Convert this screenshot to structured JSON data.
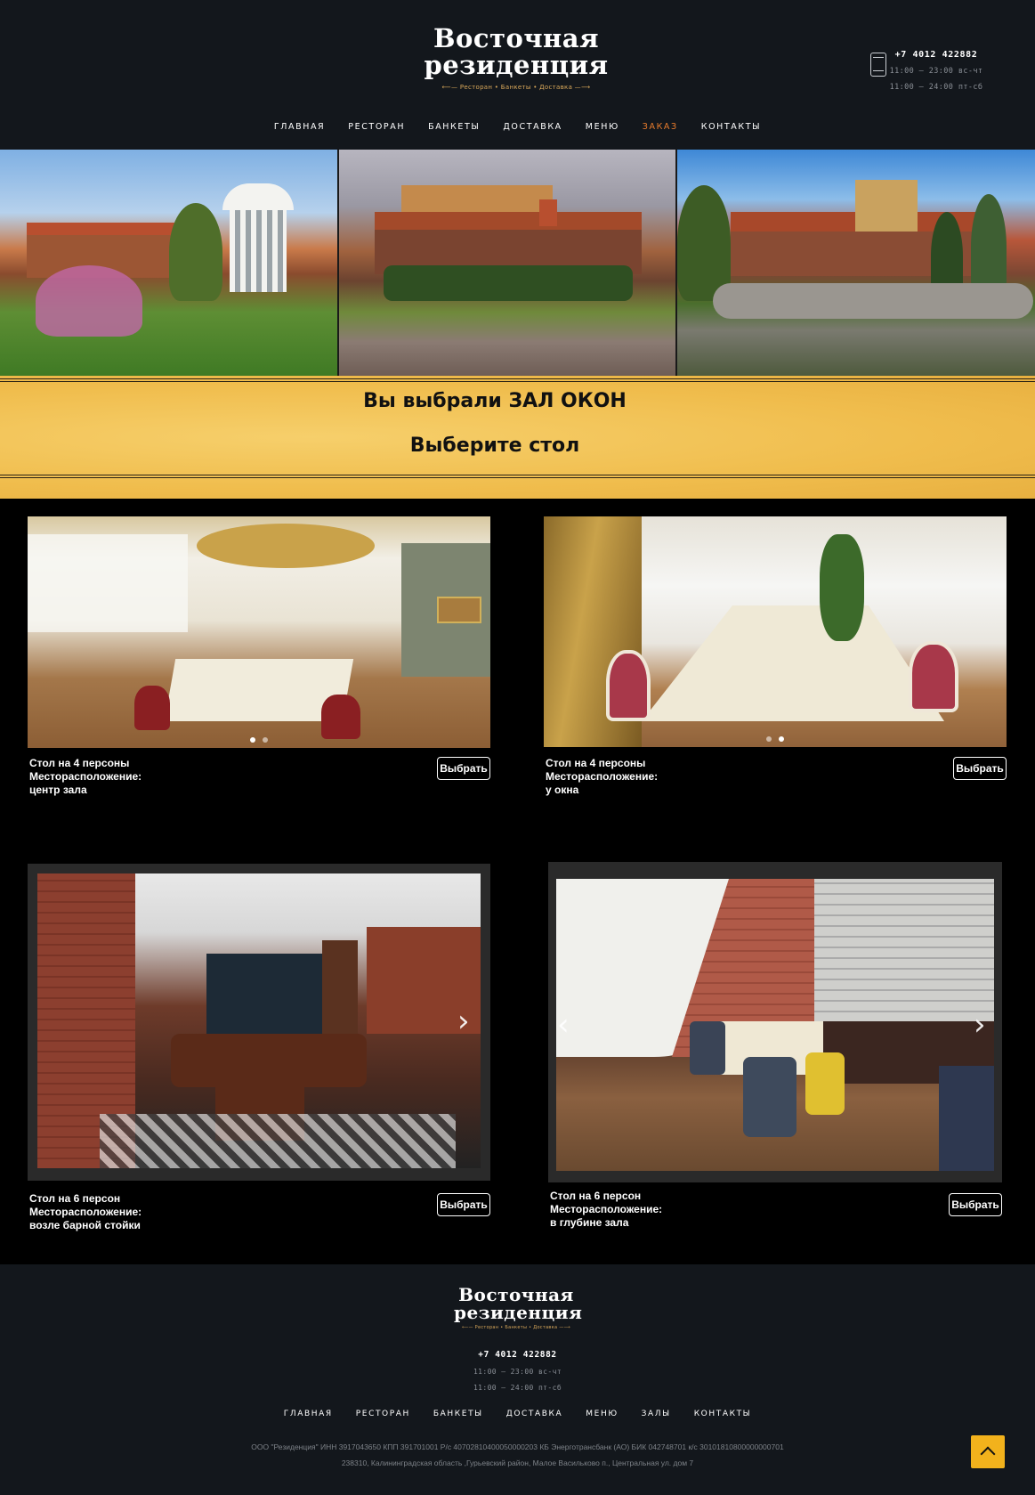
{
  "brand": {
    "title_line1": "Восточная",
    "title_line2": "резиденция",
    "tagline": "⟵— Ресторан • Банкеты • Доставка —⟶",
    "accent_color": "#e87c2d",
    "banner_color": "#f0bd4d"
  },
  "header": {
    "phone": "+7 4012 422882",
    "hours_weekdays": "11:00 – 23:00 вс-чт",
    "hours_weekend": "11:00 – 24:00 пт-сб",
    "phone_icon": "mobile-phone-icon"
  },
  "nav": {
    "items": [
      "ГЛАВНАЯ",
      "РЕСТОРАН",
      "БАНКЕТЫ",
      "ДОСТАВКА",
      "МЕНЮ",
      "ЗАКАЗ",
      "КОНТАКТЫ"
    ],
    "active": "ЗАКАЗ"
  },
  "banner": {
    "line1": "Вы выбрали ЗАЛ ОКОН",
    "line2": "Выберите стол"
  },
  "tables": [
    {
      "title": "Стол на 4 персоны",
      "location": "Месторасположение: центр зала",
      "button": "Выбрать",
      "slides": 2,
      "active_slide": 0
    },
    {
      "title": "Стол на 4 персоны",
      "location": "Месторасположение: у окна",
      "button": "Выбрать",
      "slides": 2,
      "active_slide": 1
    },
    {
      "title": "Стол на 6 персон",
      "location": "Месторасположение: возле барной стойки",
      "button": "Выбрать"
    },
    {
      "title": "Стол на 6 персон",
      "location": "Месторасположение: в глубине зала",
      "button": "Выбрать"
    }
  ],
  "footer": {
    "title_line1": "Восточная",
    "title_line2": "резиденция",
    "tagline": "⟵— Ресторан • Банкеты • Доставка —⟶",
    "phone": "+7 4012 422882",
    "hours_weekdays": "11:00 – 23:00 вс-чт",
    "hours_weekend": "11:00 – 24:00 пт-сб",
    "nav": [
      "ГЛАВНАЯ",
      "РЕСТОРАН",
      "БАНКЕТЫ",
      "ДОСТАВКА",
      "МЕНЮ",
      "ЗАЛЫ",
      "КОНТАКТЫ"
    ],
    "legal_line1": "ООО \"Резиденция\" ИНН 3917043650 КПП 391701001 Р/с 40702810400050000203 КБ Энерготрансбанк (АО) БИК 042748701 к/с 30101810800000000701",
    "legal_line2": "238310, Калининградская область ,Гурьевский район, Малое Васильково п., Центральная ул. дом 7",
    "scroll_top_icon": "chevron-up-icon"
  }
}
